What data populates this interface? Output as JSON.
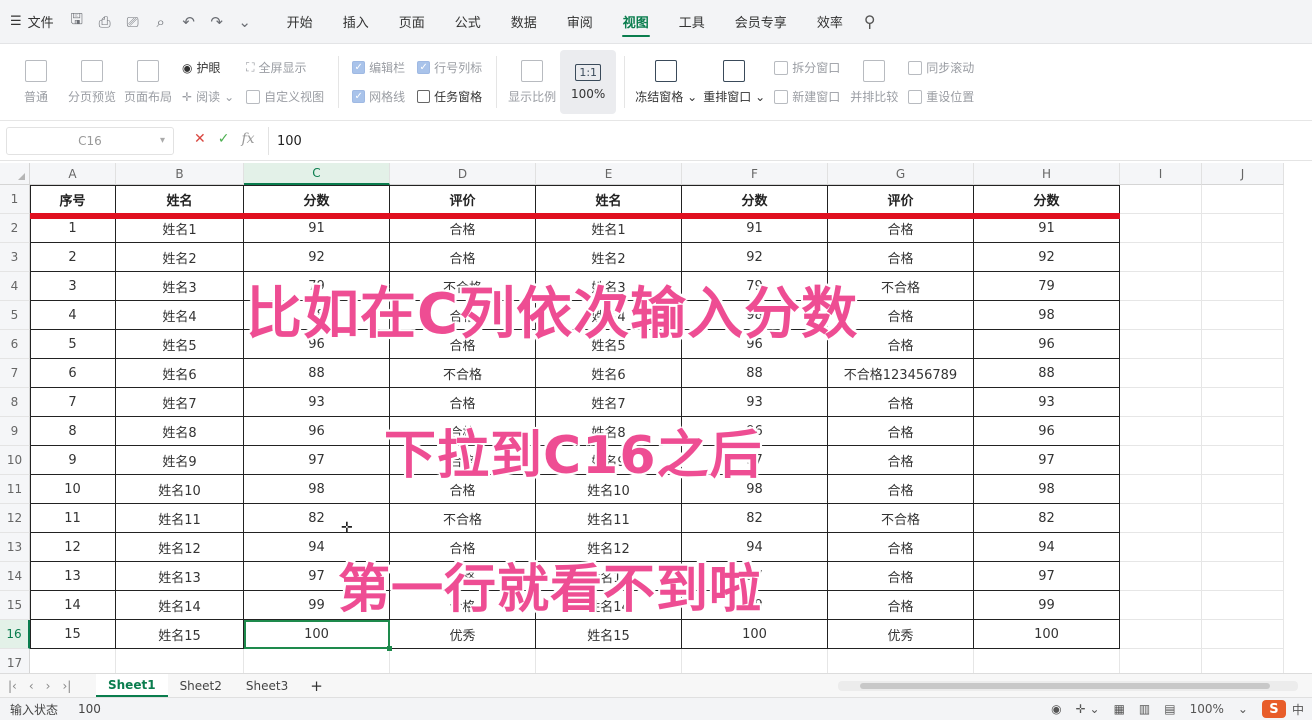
{
  "menubar": {
    "file_label": "文件",
    "tabs": [
      "开始",
      "插入",
      "页面",
      "公式",
      "数据",
      "审阅",
      "视图",
      "工具",
      "会员专享",
      "效率"
    ],
    "active_tab": "视图"
  },
  "ribbon": {
    "normal": "普通",
    "page_break_preview": "分页预览",
    "page_layout": "页面布局",
    "eye_protect": "护眼",
    "reading": "阅读",
    "fullscreen": "全屏显示",
    "custom_view": "自定义视图",
    "edit_bar": "编辑栏",
    "gridlines": "网格线",
    "row_col_headers": "行号列标",
    "task_pane": "任务窗格",
    "zoom_ratio": "显示比例",
    "zoom_100": "100%",
    "freeze_panes": "冻结窗格",
    "arrange_windows": "重排窗口",
    "split_window": "拆分窗口",
    "new_window": "新建窗口",
    "side_by_side": "并排比较",
    "sync_scroll": "同步滚动",
    "reset_position": "重设位置",
    "one_to_one": "1:1"
  },
  "formula_bar": {
    "name_box": "C16",
    "fx": "fx",
    "value": "100"
  },
  "columns": [
    "A",
    "B",
    "C",
    "D",
    "E",
    "F",
    "G",
    "H",
    "I",
    "J"
  ],
  "row_numbers": [
    "1",
    "2",
    "3",
    "4",
    "5",
    "6",
    "7",
    "8",
    "9",
    "10",
    "11",
    "12",
    "13",
    "14",
    "15",
    "16",
    "17"
  ],
  "table": {
    "headers": [
      "序号",
      "姓名",
      "分数",
      "评价",
      "姓名",
      "分数",
      "评价",
      "分数"
    ],
    "rows": [
      [
        "1",
        "姓名1",
        "91",
        "合格",
        "姓名1",
        "91",
        "合格",
        "91"
      ],
      [
        "2",
        "姓名2",
        "92",
        "合格",
        "姓名2",
        "92",
        "合格",
        "92"
      ],
      [
        "3",
        "姓名3",
        "79",
        "不合格",
        "姓名3",
        "79",
        "不合格",
        "79"
      ],
      [
        "4",
        "姓名4",
        "98",
        "合格",
        "姓名4",
        "98",
        "合格",
        "98"
      ],
      [
        "5",
        "姓名5",
        "96",
        "合格",
        "姓名5",
        "96",
        "合格",
        "96"
      ],
      [
        "6",
        "姓名6",
        "88",
        "不合格",
        "姓名6",
        "88",
        "不合格123456789",
        "88"
      ],
      [
        "7",
        "姓名7",
        "93",
        "合格",
        "姓名7",
        "93",
        "合格",
        "93"
      ],
      [
        "8",
        "姓名8",
        "96",
        "合格",
        "姓名8",
        "96",
        "合格",
        "96"
      ],
      [
        "9",
        "姓名9",
        "97",
        "合格",
        "姓名9",
        "97",
        "合格",
        "97"
      ],
      [
        "10",
        "姓名10",
        "98",
        "合格",
        "姓名10",
        "98",
        "合格",
        "98"
      ],
      [
        "11",
        "姓名11",
        "82",
        "不合格",
        "姓名11",
        "82",
        "不合格",
        "82"
      ],
      [
        "12",
        "姓名12",
        "94",
        "合格",
        "姓名12",
        "94",
        "合格",
        "94"
      ],
      [
        "13",
        "姓名13",
        "97",
        "合格",
        "姓名13",
        "97",
        "合格",
        "97"
      ],
      [
        "14",
        "姓名14",
        "99",
        "合格",
        "姓名14",
        "99",
        "合格",
        "99"
      ],
      [
        "15",
        "姓名15",
        "100",
        "优秀",
        "姓名15",
        "100",
        "优秀",
        "100"
      ]
    ]
  },
  "overlay": {
    "line1": "比如在C列依次输入分数",
    "line2": "下拉到C16之后",
    "line3": "第一行就看不到啦"
  },
  "sheet_tabs": [
    "Sheet1",
    "Sheet2",
    "Sheet3"
  ],
  "active_sheet": "Sheet1",
  "status": {
    "mode": "输入状态",
    "value": "100",
    "zoom": "100%",
    "ime_lang": "中"
  },
  "colors": {
    "accent_green": "#0a7d4e",
    "overlay_pink": "#ee4d93",
    "red_line": "#e0101f"
  }
}
